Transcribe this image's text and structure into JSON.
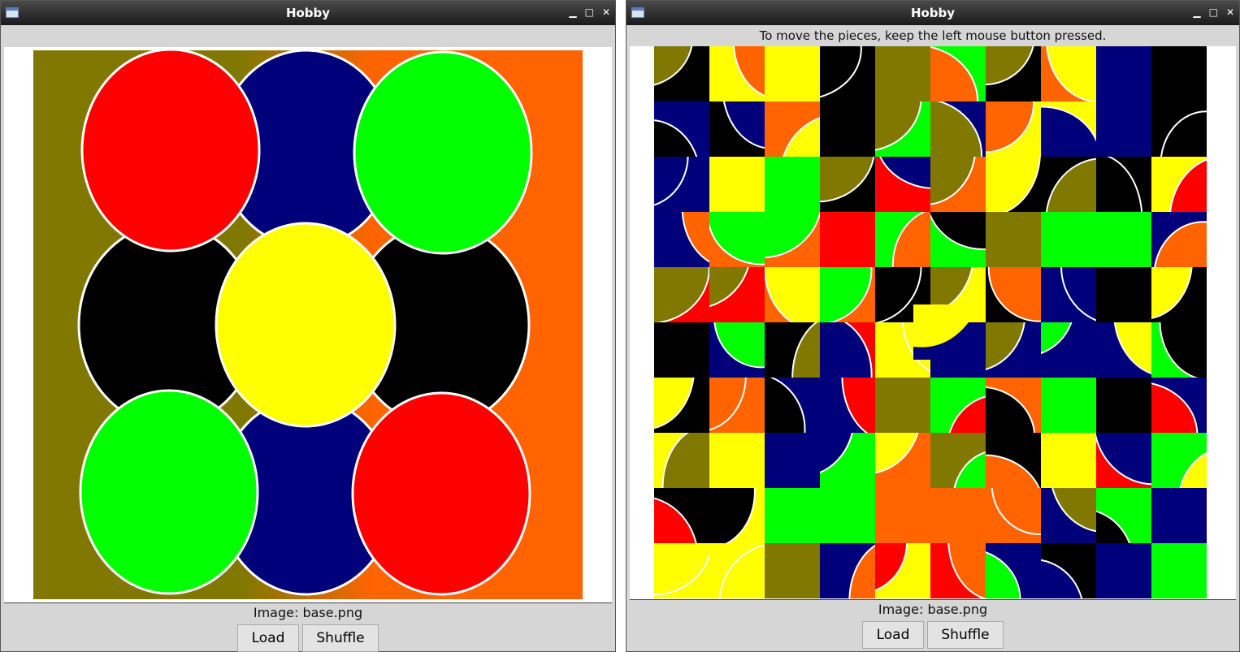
{
  "windows": [
    {
      "title": "Hobby",
      "info": "",
      "image_caption": "Image: base.png",
      "load_label": "Load",
      "shuffle_label": "Shuffle"
    },
    {
      "title": "Hobby",
      "info": "To move the pieces, keep the left mouse button pressed.",
      "image_caption": "Image: base.png",
      "load_label": "Load",
      "shuffle_label": "Shuffle"
    }
  ],
  "titlebar_icons": [
    "minimize-icon",
    "maximize-icon",
    "close-icon"
  ],
  "colors": {
    "olive": "#807800",
    "navy": "#00007a",
    "orange": "#ff6400",
    "red": "#ff0000",
    "green": "#00ff00",
    "yellow": "#ffff00",
    "black": "#000000"
  }
}
